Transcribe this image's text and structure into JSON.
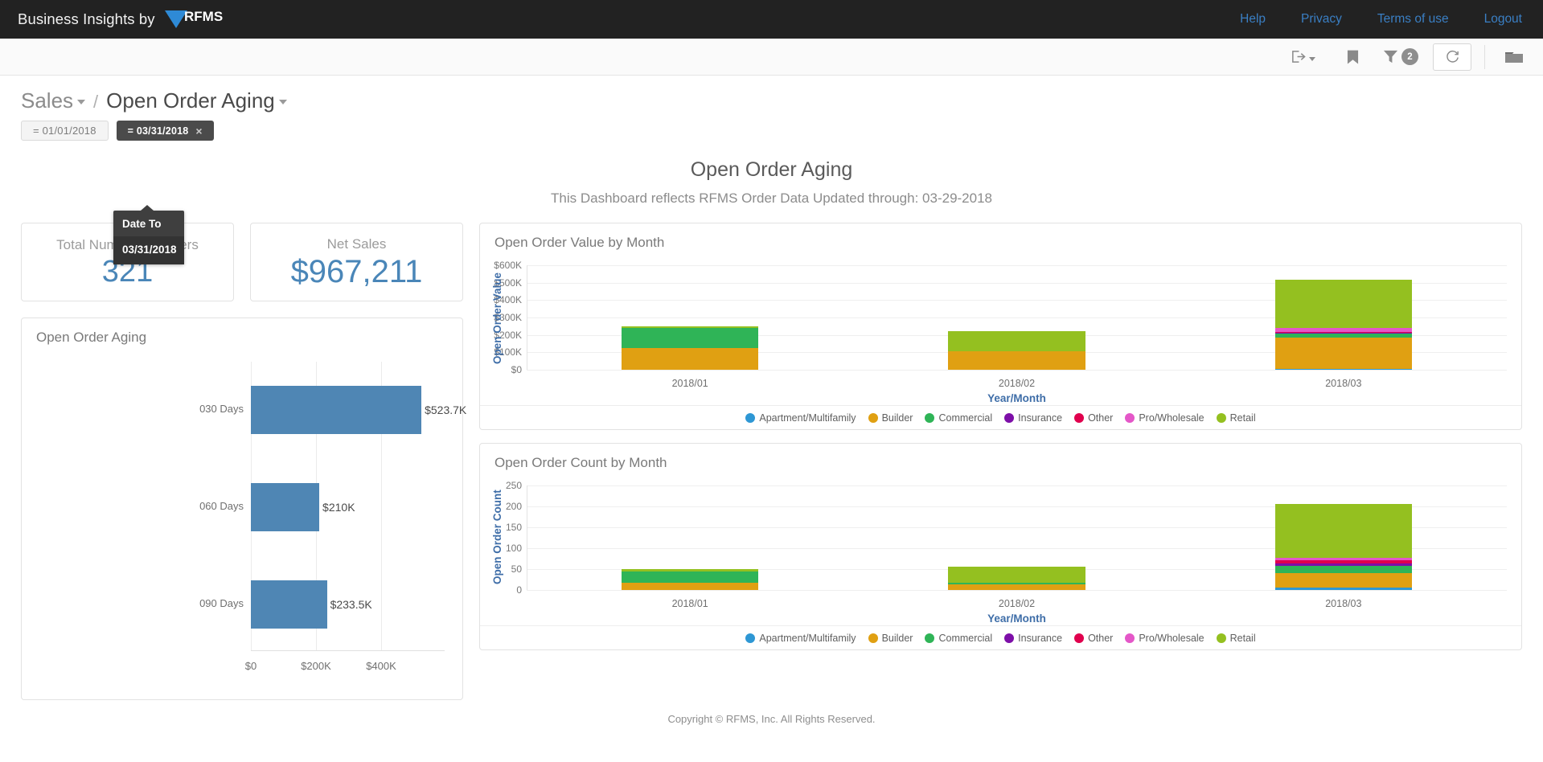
{
  "header": {
    "brand_text": "Business Insights by",
    "brand_logo_text": "RFMS",
    "nav": [
      {
        "label": "Help"
      },
      {
        "label": "Privacy"
      },
      {
        "label": "Terms of use"
      },
      {
        "label": "Logout"
      }
    ]
  },
  "toolbar": {
    "export_icon": "export-icon",
    "bookmark_icon": "bookmark-icon",
    "filter_icon": "filter-icon",
    "filter_count": "2",
    "refresh_icon": "refresh-icon",
    "folder_icon": "folder-icon"
  },
  "breadcrumb": {
    "parent": "Sales",
    "separator": "/",
    "current": "Open Order Aging"
  },
  "filters": {
    "chips": [
      {
        "label": "= 01/01/2018",
        "state": "inactive",
        "removable": false
      },
      {
        "label": "= 03/31/2018",
        "state": "active",
        "removable": true,
        "remove_label": "×"
      }
    ],
    "tooltip": {
      "title": "Date To",
      "value": "03/31/2018"
    }
  },
  "dashboard": {
    "title": "Open Order Aging",
    "subtitle": "This Dashboard reflects RFMS Order Data Updated through: 03-29-2018"
  },
  "kpis": [
    {
      "label": "Total Number of Orders",
      "value": "321"
    },
    {
      "label": "Net Sales",
      "value": "$967,211"
    }
  ],
  "footer": {
    "text": "Copyright © RFMS, Inc.  All Rights Reserved."
  },
  "colors": {
    "accent_blue": "#4a86b8",
    "bar_blue": "#4f86b4",
    "axis_title_blue": "#3f6ea8",
    "topbar": "#222222",
    "link": "#3a7fc4"
  },
  "chart_data": [
    {
      "id": "open-order-aging",
      "type": "bar",
      "orientation": "horizontal",
      "title": "Open Order Aging",
      "categories": [
        "030 Days",
        "060 Days",
        "090 Days"
      ],
      "values": [
        523700,
        210000,
        233500
      ],
      "data_labels": [
        "$523.7K",
        "$210K",
        "$233.5K"
      ],
      "xlabel": "",
      "ylabel": "",
      "xticks": [
        "$0",
        "$200K",
        "$400K"
      ],
      "xtick_values": [
        0,
        200000,
        400000
      ],
      "xlim": [
        0,
        600000
      ],
      "grid": true,
      "legend": false,
      "series_color": "#4f86b4"
    },
    {
      "id": "open-order-value-by-month",
      "type": "bar",
      "stacked": true,
      "title": "Open Order Value by Month",
      "xlabel": "Year/Month",
      "ylabel": "Open Order Value",
      "categories": [
        "2018/01",
        "2018/02",
        "2018/03"
      ],
      "yticks": [
        "$0",
        "$100K",
        "$200K",
        "$300K",
        "$400K",
        "$500K",
        "$600K"
      ],
      "ytick_values": [
        0,
        100000,
        200000,
        300000,
        400000,
        500000,
        600000
      ],
      "ylim": [
        0,
        600000
      ],
      "grid": true,
      "legend_position": "bottom",
      "series": [
        {
          "name": "Apartment/Multifamily",
          "color": "#2e97d4",
          "values": [
            0,
            0,
            4000
          ]
        },
        {
          "name": "Builder",
          "color": "#e0a012",
          "values": [
            124000,
            104000,
            180000
          ]
        },
        {
          "name": "Commercial",
          "color": "#2fb457",
          "values": [
            116000,
            4000,
            22000
          ]
        },
        {
          "name": "Insurance",
          "color": "#7d0fa8",
          "values": [
            0,
            0,
            8000
          ]
        },
        {
          "name": "Other",
          "color": "#e0004d",
          "values": [
            0,
            0,
            3000
          ]
        },
        {
          "name": "Pro/Wholesale",
          "color": "#e457c8",
          "values": [
            2000,
            0,
            21000
          ]
        },
        {
          "name": "Retail",
          "color": "#94c020",
          "values": [
            6000,
            112000,
            280000
          ]
        }
      ]
    },
    {
      "id": "open-order-count-by-month",
      "type": "bar",
      "stacked": true,
      "title": "Open Order Count by Month",
      "xlabel": "Year/Month",
      "ylabel": "Open Order Count",
      "categories": [
        "2018/01",
        "2018/02",
        "2018/03"
      ],
      "yticks": [
        "0",
        "50",
        "100",
        "150",
        "200",
        "250"
      ],
      "ytick_values": [
        0,
        50,
        100,
        150,
        200,
        250
      ],
      "ylim": [
        0,
        250
      ],
      "grid": true,
      "legend_position": "bottom",
      "series": [
        {
          "name": "Apartment/Multifamily",
          "color": "#2e97d4",
          "values": [
            0,
            0,
            6
          ]
        },
        {
          "name": "Builder",
          "color": "#e0a012",
          "values": [
            17,
            14,
            35
          ]
        },
        {
          "name": "Commercial",
          "color": "#2fb457",
          "values": [
            27,
            3,
            16
          ]
        },
        {
          "name": "Insurance",
          "color": "#7d0fa8",
          "values": [
            0,
            0,
            7
          ]
        },
        {
          "name": "Other",
          "color": "#e0004d",
          "values": [
            1,
            0,
            8
          ]
        },
        {
          "name": "Pro/Wholesale",
          "color": "#e457c8",
          "values": [
            0,
            0,
            5
          ]
        },
        {
          "name": "Retail",
          "color": "#94c020",
          "values": [
            6,
            38,
            128
          ]
        }
      ]
    }
  ]
}
